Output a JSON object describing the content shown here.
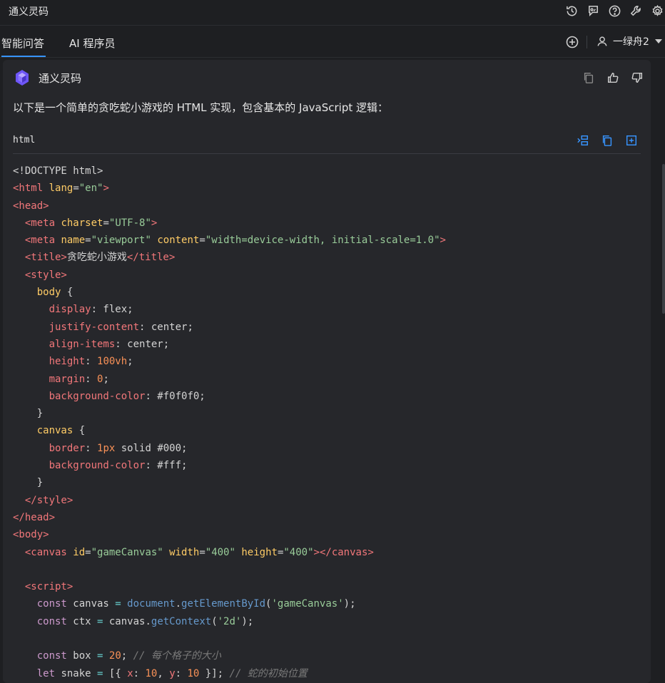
{
  "titlebar": {
    "title": "通义灵码",
    "icons": [
      "history-icon",
      "feedback-icon",
      "help-icon",
      "wrench-icon",
      "gear-icon"
    ]
  },
  "tabs": [
    {
      "label": "智能问答",
      "active": true
    },
    {
      "label": "AI 程序员",
      "active": false
    }
  ],
  "user": {
    "name": "一绿舟2"
  },
  "message": {
    "sender": "通义灵码",
    "intro": "以下是一个简单的贪吃蛇小游戏的 HTML 实现，包含基本的 JavaScript 逻辑：",
    "code_lang": "html"
  },
  "code": {
    "l1": "<!DOCTYPE html>",
    "l2": [
      "<html",
      " lang",
      "=",
      "\"en\"",
      ">"
    ],
    "l3": "<head>",
    "l4": [
      "  <meta",
      " charset",
      "=",
      "\"UTF-8\"",
      ">"
    ],
    "l5": [
      "  <meta",
      " name",
      "=",
      "\"viewport\"",
      " content",
      "=",
      "\"width=device-width, initial-scale=1.0\"",
      ">"
    ],
    "l6": [
      "  <title>",
      "贪吃蛇小游戏",
      "</title>"
    ],
    "l7": "  <style>",
    "l8": [
      "    body",
      " {"
    ],
    "l9": [
      "      display",
      ": flex;"
    ],
    "l10": [
      "      justify-content",
      ": center;"
    ],
    "l11": [
      "      align-items",
      ": center;"
    ],
    "l12": [
      "      height",
      ": ",
      "100vh",
      ";"
    ],
    "l13": [
      "      margin",
      ": ",
      "0",
      ";"
    ],
    "l14": [
      "      background-color",
      ": #f0f0f0;"
    ],
    "l15": "    }",
    "l16": [
      "    canvas",
      " {"
    ],
    "l17": [
      "      border",
      ": ",
      "1px",
      " solid #000;"
    ],
    "l18": [
      "      background-color",
      ": #fff;"
    ],
    "l19": "    }",
    "l20": "  </style>",
    "l21": "</head>",
    "l22": "<body>",
    "l23": [
      "  <canvas",
      " id",
      "=",
      "\"gameCanvas\"",
      " width",
      "=",
      "\"400\"",
      " height",
      "=",
      "\"400\"",
      "></canvas>"
    ],
    "l24": "",
    "l25": "  <script>",
    "l26": [
      "    const",
      " canvas ",
      "=",
      " document",
      ".",
      "getElementById",
      "(",
      "'gameCanvas'",
      ");"
    ],
    "l27": [
      "    const",
      " ctx ",
      "=",
      " canvas.",
      "getContext",
      "(",
      "'2d'",
      ");"
    ],
    "l28": "",
    "l29": [
      "    const",
      " box ",
      "=",
      " ",
      "20",
      "; ",
      "// 每个格子的大小"
    ],
    "l30": [
      "    let",
      " snake ",
      "=",
      " [{ ",
      "x",
      ": ",
      "10",
      ", ",
      "y",
      ": ",
      "10",
      " }]; ",
      "// 蛇的初始位置"
    ]
  },
  "colors": {
    "background": "#1e1f22",
    "card": "#26272b",
    "accent": "#3794ff",
    "logo": "#7b61ff"
  }
}
